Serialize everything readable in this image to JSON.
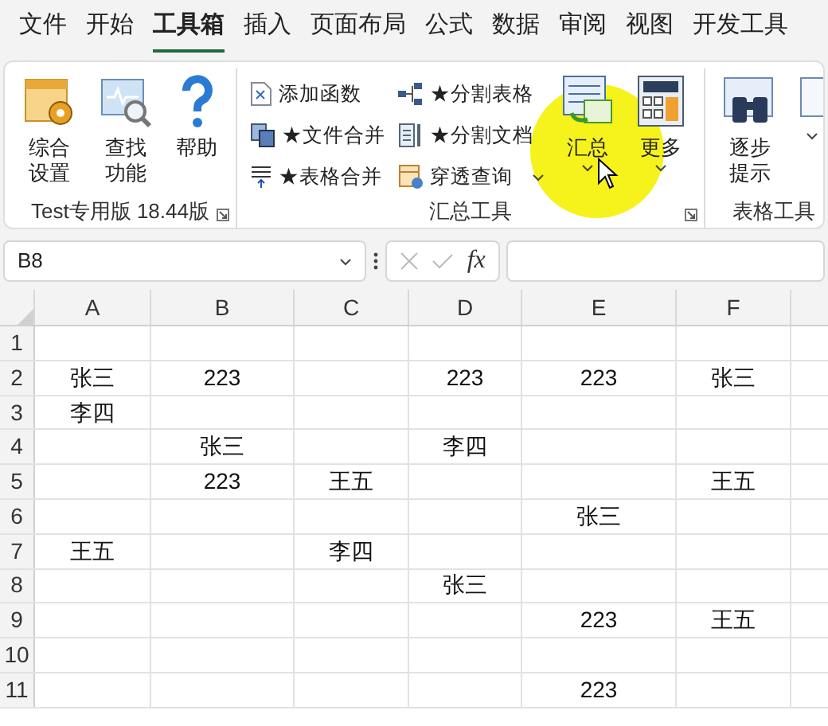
{
  "menu_tabs": [
    {
      "label": "文件",
      "selected": false
    },
    {
      "label": "开始",
      "selected": false
    },
    {
      "label": "工具箱",
      "selected": true
    },
    {
      "label": "插入",
      "selected": false
    },
    {
      "label": "页面布局",
      "selected": false
    },
    {
      "label": "公式",
      "selected": false
    },
    {
      "label": "数据",
      "selected": false
    },
    {
      "label": "审阅",
      "selected": false
    },
    {
      "label": "视图",
      "selected": false
    },
    {
      "label": "开发工具",
      "selected": false
    }
  ],
  "ribbon": {
    "groups": [
      {
        "title": "Test专用版 18.44版",
        "launcher": true,
        "items": [
          {
            "kind": "large",
            "label": "综合设置"
          },
          {
            "kind": "large",
            "label": "查找功能"
          },
          {
            "kind": "large",
            "label": "帮助"
          }
        ]
      },
      {
        "title": "汇总工具",
        "launcher": true,
        "items": [
          {
            "kind": "small",
            "label": "添加函数"
          },
          {
            "kind": "small",
            "label": "★文件合并"
          },
          {
            "kind": "small",
            "label": "★表格合并"
          },
          {
            "kind": "small",
            "label": "★分割表格"
          },
          {
            "kind": "small",
            "label": "★分割文档"
          },
          {
            "kind": "small",
            "label": "穿透查询",
            "dropdown": true
          },
          {
            "kind": "large",
            "label": "汇总",
            "dropdown": true
          },
          {
            "kind": "large",
            "label": "更多",
            "dropdown": true
          }
        ]
      },
      {
        "title": "表格工具",
        "items": [
          {
            "kind": "large",
            "label": "逐步提示"
          },
          {
            "kind": "large",
            "dropdown": true
          }
        ]
      }
    ]
  },
  "formula_bar": {
    "name_box": "B8",
    "fx": "fx"
  },
  "sheet": {
    "columns": [
      "A",
      "B",
      "C",
      "D",
      "E",
      "F"
    ],
    "rows": [
      {
        "header": "1",
        "cells": {}
      },
      {
        "header": "2",
        "cells": {
          "A": "张三",
          "B": "223",
          "D": "223",
          "E": "223",
          "F": "张三"
        }
      },
      {
        "header": "3",
        "cells": {
          "A": "李四"
        }
      },
      {
        "header": "4",
        "cells": {
          "B": "张三",
          "D": "李四"
        }
      },
      {
        "header": "5",
        "cells": {
          "B": "223",
          "C": "王五",
          "F": "王五"
        }
      },
      {
        "header": "6",
        "cells": {
          "E": "张三"
        }
      },
      {
        "header": "7",
        "cells": {
          "A": "王五",
          "C": "李四"
        }
      },
      {
        "header": "8",
        "cells": {
          "D": "张三"
        }
      },
      {
        "header": "9",
        "cells": {
          "E": "223",
          "F": "王五"
        }
      },
      {
        "header": "10",
        "cells": {}
      },
      {
        "header": "11",
        "cells": {
          "E": "223"
        }
      }
    ]
  }
}
